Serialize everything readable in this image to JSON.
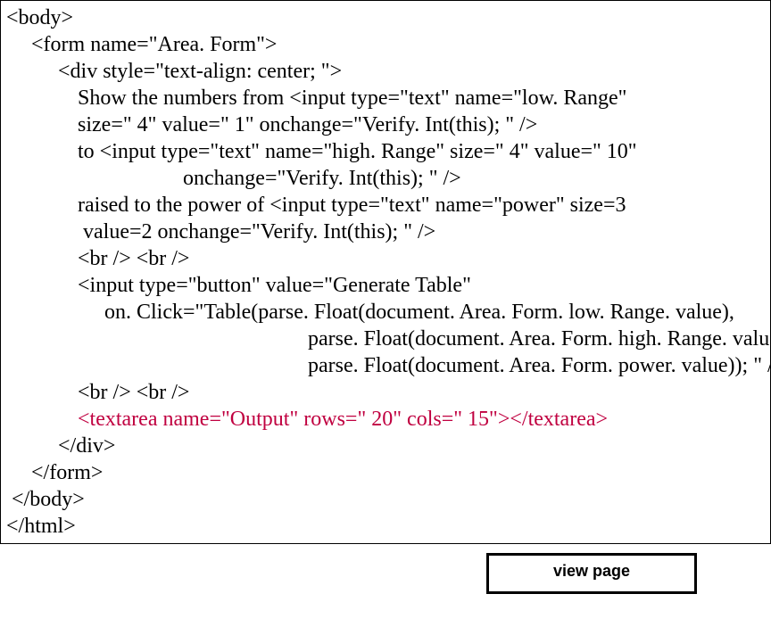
{
  "code": {
    "l1": "<body>",
    "l2": "  <form name=\"Area. Form\">",
    "l3": "    <div style=\"text-align: center; \">",
    "l4": "     Show the numbers from <input type=\"text\" name=\"low. Range\"",
    "l5": "     size=\" 4\" value=\" 1\" onchange=\"Verify. Int(this); \" />",
    "l6": "     to <input type=\"text\" name=\"high. Range\" size=\" 4\" value=\" 10\"",
    "l7": "              onchange=\"Verify. Int(this); \" />",
    "l8": "     raised to the power of <input type=\"text\" name=\"power\" size=3",
    "l9": "      value=2 onchange=\"Verify. Int(this); \" />",
    "l10": "     <br /> <br />",
    "l11": "     <input type=\"button\" value=\"Generate Table\"",
    "l12": "          on. Click=\"Table(parse. Float(document. Area. Form. low. Range. value),",
    "l13": "                        parse. Float(document. Area. Form. high. Range. value),",
    "l14": "                        parse. Float(document. Area. Form. power. value)); \" />",
    "l15": "     <br /> <br />",
    "l16": "     <textarea name=\"Output\" rows=\" 20\" cols=\" 15\"></textarea>",
    "l17": "    </div>",
    "l18": "  </form>",
    "l19": " </body>",
    "l20": "</html>"
  },
  "button": {
    "view_label": "view page"
  }
}
